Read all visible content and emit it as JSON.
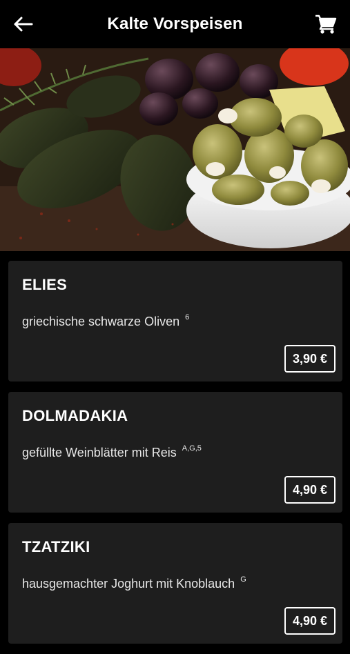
{
  "header": {
    "title": "Kalte Vorspeisen",
    "back_icon": "arrow-left-icon",
    "cart_icon": "shopping-cart-icon"
  },
  "hero": {
    "subject": "olives and stuffed vine leaves"
  },
  "items": [
    {
      "name": "ELIES",
      "description": "griechische schwarze Oliven",
      "allergens": "6",
      "price": "3,90 €"
    },
    {
      "name": "DOLMADAKIA",
      "description": "gefüllte Weinblätter mit Reis",
      "allergens": "A,G,5",
      "price": "4,90 €"
    },
    {
      "name": "TZATZIKI",
      "description": "hausgemachter Joghurt mit Knoblauch",
      "allergens": "G",
      "price": "4,90 €"
    }
  ],
  "colors": {
    "background": "#000000",
    "card": "#1e1e1e",
    "text": "#ffffff"
  }
}
